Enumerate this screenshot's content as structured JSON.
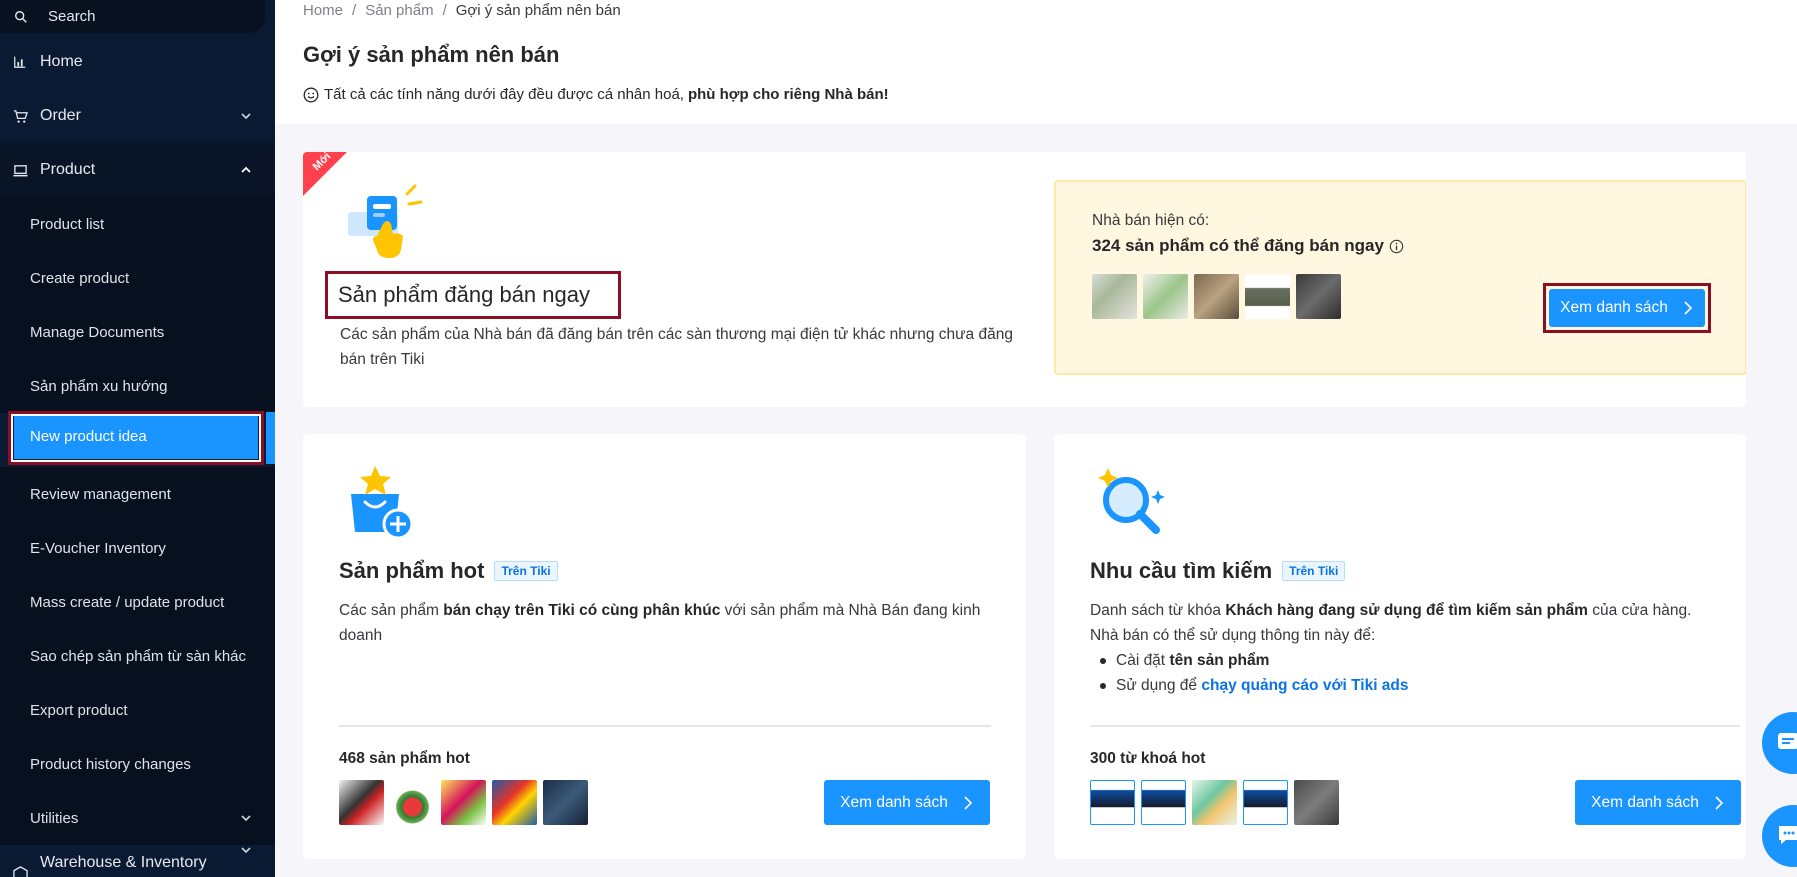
{
  "sidebar": {
    "search_label": "Search",
    "home_label": "Home",
    "order_label": "Order",
    "product_label": "Product",
    "items": [
      "Product list",
      "Create product",
      "Manage Documents",
      "Sản phẩm xu hướng",
      "New product idea",
      "Review management",
      "E-Voucher Inventory",
      "Mass create / update product",
      "Sao chép sản phẩm từ sàn khác",
      "Export product",
      "Product history changes",
      "Utilities"
    ],
    "warehouse_label": "Warehouse & Inventory"
  },
  "breadcrumb": {
    "home": "Home",
    "product": "Sản phẩm",
    "current": "Gợi ý sản phẩm nên bán",
    "sep": "/"
  },
  "page": {
    "title": "Gợi ý sản phẩm nên bán",
    "subtitle_text": "Tất cả các tính năng dưới đây đều được cá nhân hoá,",
    "subtitle_bold": "phù hợp cho riêng Nhà bán!"
  },
  "card_ready": {
    "ribbon": "Mới",
    "title": "Sản phẩm đăng bán ngay",
    "desc": "Các sản phẩm của Nhà bán đã đăng bán trên các sàn thương mại điện tử khác nhưng chưa đăng bán trên Tiki",
    "panel_label": "Nhà bán hiện có:",
    "panel_count": "324 sản phẩm có thể đăng bán ngay",
    "button": "Xem danh sách"
  },
  "card_hot": {
    "title": "Sản phẩm hot",
    "badge": "Trên Tiki",
    "desc_1": "Các sản phẩm",
    "desc_bold": "bán chạy trên Tiki có cùng phân khúc",
    "desc_2": "với sản phẩm mà Nhà Bán đang kinh doanh",
    "count": "468 sản phẩm hot",
    "button": "Xem danh sách"
  },
  "card_search": {
    "title": "Nhu cầu tìm kiếm",
    "badge": "Trên Tiki",
    "desc_1": "Danh sách từ khóa",
    "desc_bold": "Khách hàng đang sử dụng để tìm kiếm sản phẩm",
    "desc_2": "của cửa hàng.",
    "desc_line2": "Nhà bán có thể sử dụng thông tin này để:",
    "bullet1_text": "Cài đặt",
    "bullet1_bold": "tên sản phẩm",
    "bullet2_text": "Sử dụng để",
    "bullet2_link": "chạy quảng cáo với Tiki ads",
    "count": "300 từ khoá hot",
    "button": "Xem danh sách"
  },
  "colors": {
    "sidebar_bg": "#0b1a33",
    "accent": "#1a94ff",
    "highlight_outline": "#8b0e22",
    "panel_bg": "#fff7df"
  }
}
